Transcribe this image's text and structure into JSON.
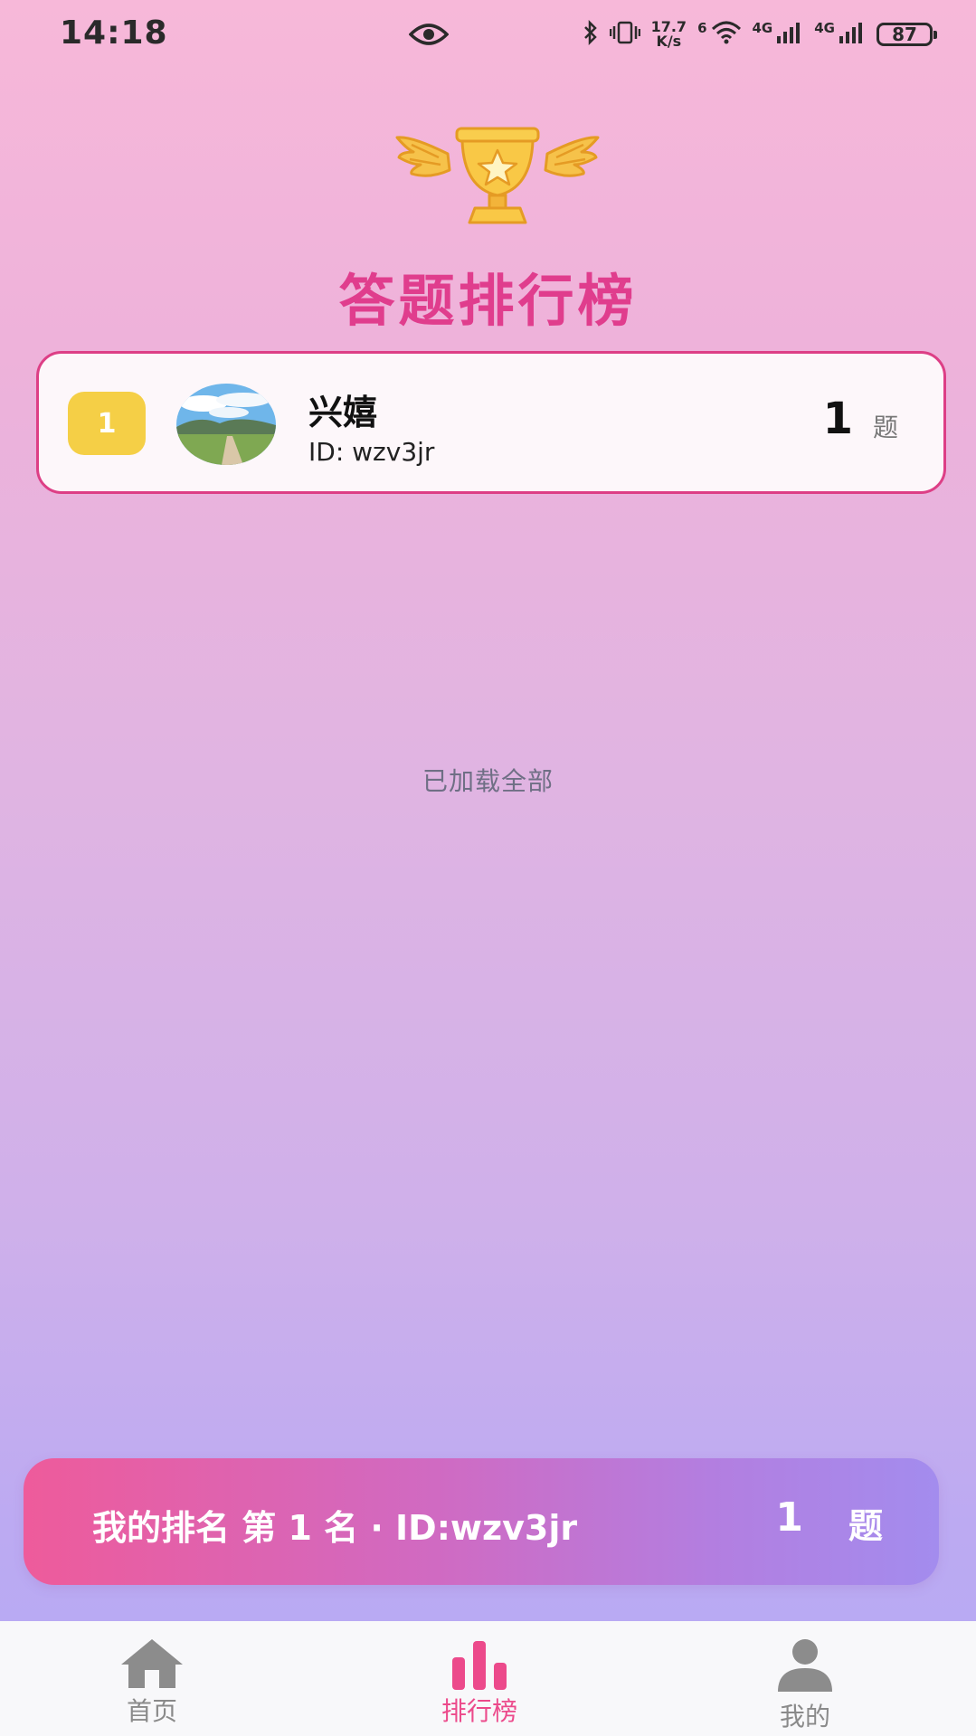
{
  "status_bar": {
    "time": "14:18",
    "net_speed_value": "17.7",
    "net_speed_unit": "K/s",
    "wifi_badge": "6",
    "sim1_label": "4G",
    "sim2_label": "4G",
    "battery": "87"
  },
  "header": {
    "title": "答题排行榜"
  },
  "leaderboard": {
    "rows": [
      {
        "rank": "1",
        "name": "兴嬉",
        "id": "ID: wzv3jr",
        "score": "1",
        "unit": "题"
      }
    ],
    "footer": "已加载全部"
  },
  "my_rank": {
    "text": "我的排名 第 1 名 · ID:wzv3jr",
    "score": "1",
    "unit": "题"
  },
  "nav": {
    "items": [
      {
        "label": "首页",
        "icon": "home-icon",
        "active": false
      },
      {
        "label": "排行榜",
        "icon": "bar-chart-icon",
        "active": true
      },
      {
        "label": "我的",
        "icon": "person-icon",
        "active": false
      }
    ]
  },
  "colors": {
    "accent": "#e03d8d",
    "badge": "#f5cf46",
    "nav_active": "#ec4a8b",
    "nav_inactive": "#8a8a8a"
  }
}
